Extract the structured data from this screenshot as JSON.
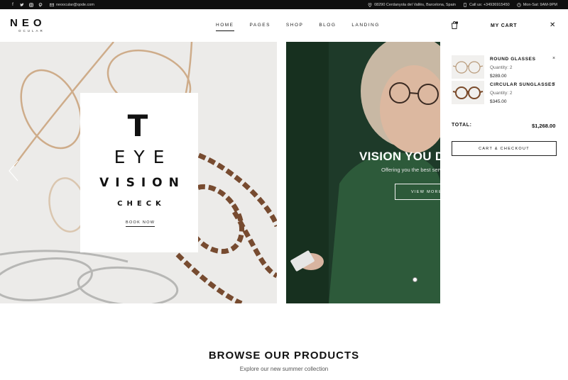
{
  "topbar": {
    "socials": [
      "facebook-icon",
      "twitter-icon",
      "instagram-icon",
      "pinterest-icon"
    ],
    "email": "neoocular@qode.com",
    "address": "08290 Cerdanyola del Vallès, Barcelona, Spain",
    "phone": "Call us: +34936915450",
    "hours": "Mon-Sat: 9AM-9PM"
  },
  "logo": {
    "brand": "NEO",
    "sub": "OCULAR"
  },
  "nav": [
    "HOME",
    "PAGES",
    "SHOP",
    "BLOG",
    "LANDING"
  ],
  "hero": {
    "card": {
      "line1": "T",
      "line2": "EYE",
      "line3": "VISION",
      "line4": "CHECK",
      "button": "BOOK NOW"
    },
    "slide2": {
      "title": "VISION YOU D",
      "subtitle": "Offering you the best serv",
      "button": "VIEW MORE"
    }
  },
  "cart": {
    "title": "MY CART",
    "items": [
      {
        "name": "ROUND GLASSES",
        "quantity": "Quantity: 2",
        "price": "$289.00"
      },
      {
        "name": "CIRCULAR SUNGLASSES",
        "quantity": "Quantity: 2",
        "price": "$345.00"
      }
    ],
    "total_label": "TOTAL:",
    "total_value": "$1,268.00",
    "checkout": "CART & CHECKOUT"
  },
  "browse": {
    "title": "BROWSE OUR PRODUCTS",
    "subtitle": "Explore our new summer collection"
  },
  "colors": {
    "topbar": "#0f0f0f",
    "hero_left_bg": "#ecebe9",
    "hero_right_bg": "#1f3b2a"
  }
}
